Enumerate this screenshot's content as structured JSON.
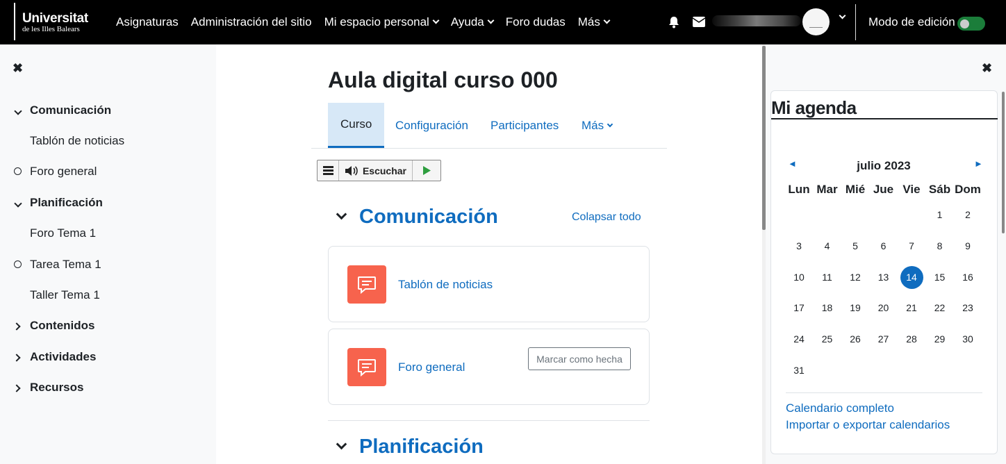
{
  "navbar": {
    "logo_line1": "Universitat",
    "logo_line2": "de les Illes Balears",
    "links": [
      "Asignaturas",
      "Administración del sitio",
      "Mi espacio personal",
      "Ayuda",
      "Foro dudas",
      "Más"
    ],
    "edit_mode_label": "Modo de edición",
    "edit_mode_on": false
  },
  "left_drawer": {
    "items": [
      {
        "label": "Comunicación",
        "kind": "section-expanded"
      },
      {
        "label": "Tablón de noticias",
        "kind": "activity"
      },
      {
        "label": "Foro general",
        "kind": "activity-circle"
      },
      {
        "label": "Planificación",
        "kind": "section-expanded"
      },
      {
        "label": "Foro Tema 1",
        "kind": "activity"
      },
      {
        "label": "Tarea Tema 1",
        "kind": "activity-circle"
      },
      {
        "label": "Taller Tema 1",
        "kind": "activity"
      },
      {
        "label": "Contenidos",
        "kind": "section-collapsed"
      },
      {
        "label": "Actividades",
        "kind": "section-collapsed"
      },
      {
        "label": "Recursos",
        "kind": "section-collapsed"
      }
    ]
  },
  "main": {
    "title": "Aula digital curso 000",
    "tabs": [
      "Curso",
      "Configuración",
      "Participantes",
      "Más"
    ],
    "speak_label": "Escuchar",
    "section1_title": "Comunicación",
    "collapse_all": "Colapsar todo",
    "activities": [
      {
        "name": "Tablón de noticias"
      },
      {
        "name": "Foro general",
        "button": "Marcar como hecha"
      }
    ],
    "section2_title": "Planificación"
  },
  "agenda": {
    "title": "Mi agenda",
    "month": "julio 2023",
    "weekdays": [
      "Lun",
      "Mar",
      "Mié",
      "Jue",
      "Vie",
      "Sáb",
      "Dom"
    ],
    "weeks": [
      [
        "",
        "",
        "",
        "",
        "",
        "1",
        "2"
      ],
      [
        "3",
        "4",
        "5",
        "6",
        "7",
        "8",
        "9"
      ],
      [
        "10",
        "11",
        "12",
        "13",
        "14",
        "15",
        "16"
      ],
      [
        "17",
        "18",
        "19",
        "20",
        "21",
        "22",
        "23"
      ],
      [
        "24",
        "25",
        "26",
        "27",
        "28",
        "29",
        "30"
      ],
      [
        "31",
        "",
        "",
        "",
        "",
        "",
        ""
      ]
    ],
    "today": "14",
    "full_calendar": "Calendario completo",
    "import_export": "Importar o exportar calendarios",
    "prev_glyph": "◄",
    "next_glyph": "►"
  },
  "colors": {
    "accent": "#0f6cbf",
    "activity_icon": "#f7634d"
  }
}
